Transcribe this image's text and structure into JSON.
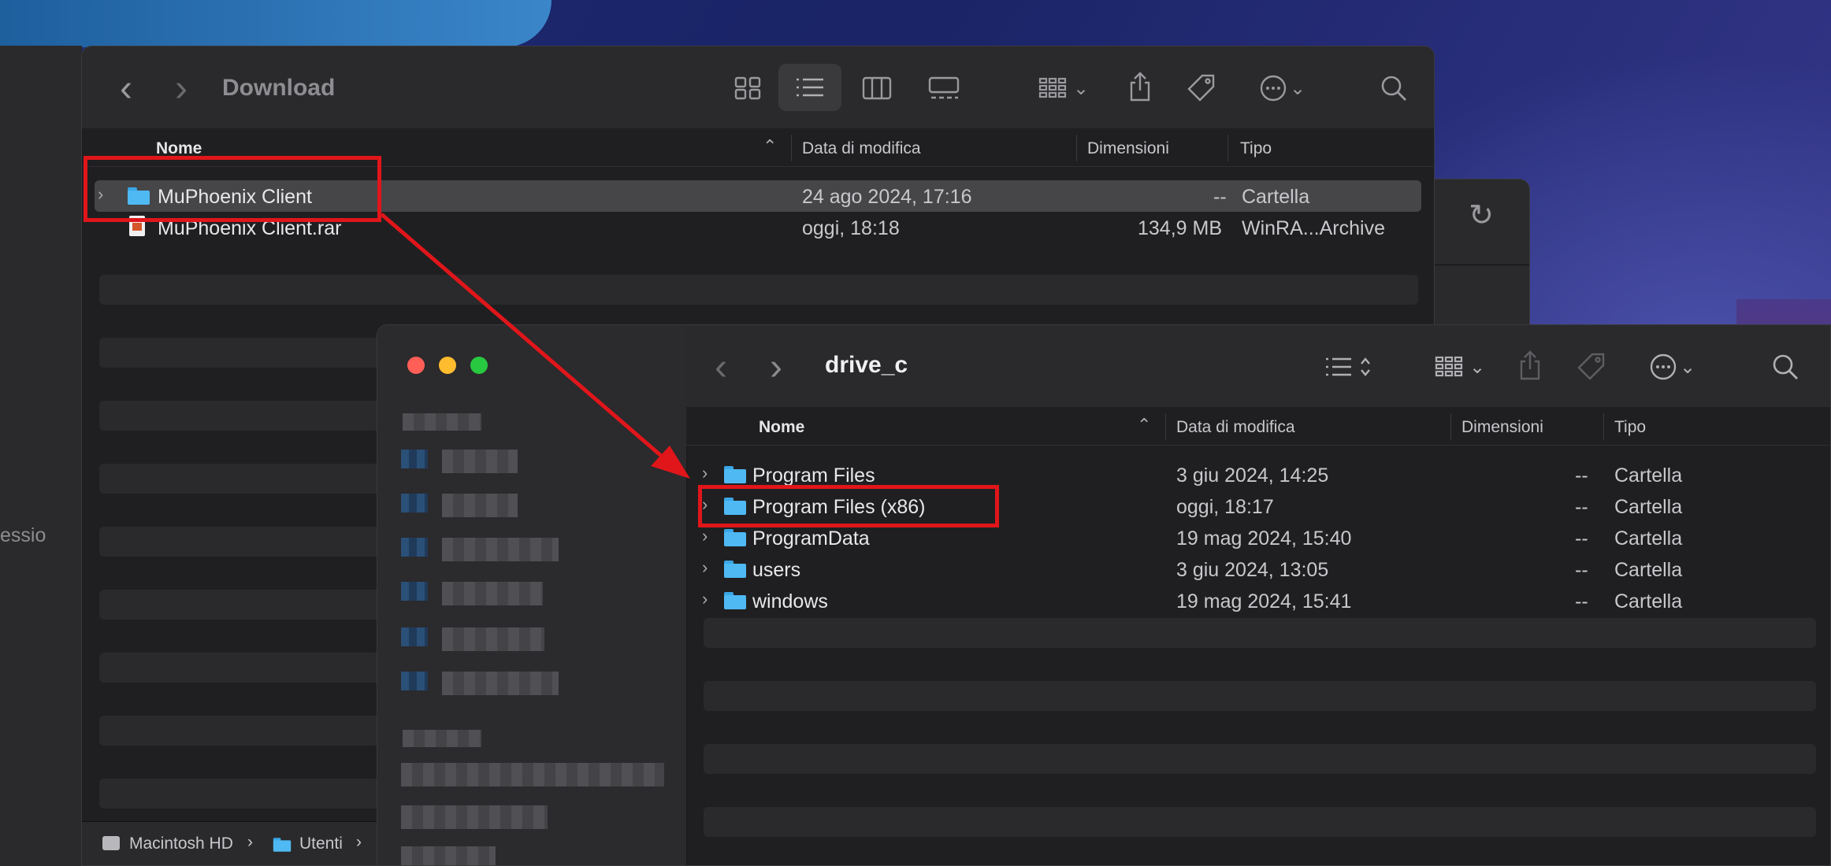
{
  "back_window": {
    "title": "Download",
    "columns": {
      "name": "Nome",
      "date": "Data di modifica",
      "size": "Dimensioni",
      "kind": "Tipo"
    },
    "rows": [
      {
        "name": "MuPhoenix Client",
        "date": "24 ago 2024, 17:16",
        "size": "--",
        "kind": "Cartella",
        "type": "folder"
      },
      {
        "name": "MuPhoenix Client.rar",
        "date": "oggi, 18:18",
        "size": "134,9 MB",
        "kind": "WinRA...Archive",
        "type": "archive"
      }
    ],
    "path": {
      "disk": "Macintosh HD",
      "sep": "›",
      "folder": "Utenti"
    }
  },
  "left_ghost": {
    "text": "essio"
  },
  "front_window": {
    "title": "drive_c",
    "columns": {
      "name": "Nome",
      "date": "Data di modifica",
      "size": "Dimensioni",
      "kind": "Tipo"
    },
    "rows": [
      {
        "name": "Program Files",
        "date": "3 giu 2024, 14:25",
        "size": "--",
        "kind": "Cartella"
      },
      {
        "name": "Program Files (x86)",
        "date": "oggi, 18:17",
        "size": "--",
        "kind": "Cartella"
      },
      {
        "name": "ProgramData",
        "date": "19 mag 2024, 15:40",
        "size": "--",
        "kind": "Cartella"
      },
      {
        "name": "users",
        "date": "3 giu 2024, 13:05",
        "size": "--",
        "kind": "Cartella"
      },
      {
        "name": "windows",
        "date": "19 mag 2024, 15:41",
        "size": "--",
        "kind": "Cartella"
      }
    ]
  },
  "icons": {
    "back": "‹",
    "forward": "›",
    "sort_up": "⌃",
    "row_chevron": "›",
    "search": "⌕",
    "refresh": "↻",
    "more": "⋯",
    "dropdown": "⌄"
  },
  "colors": {
    "annotation": "#e0161a",
    "folder": "#4fb9f3",
    "selection": "#464648"
  }
}
